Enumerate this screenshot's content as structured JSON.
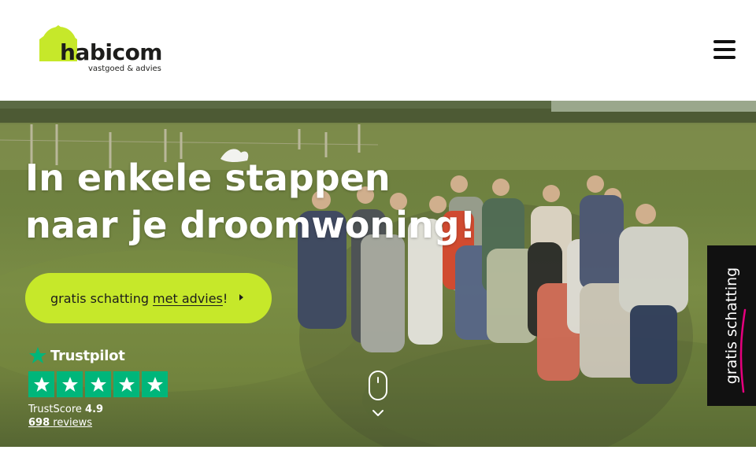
{
  "header": {
    "logo": {
      "word": "habicom",
      "tagline": "vastgoed & advies"
    },
    "menu_icon": "hamburger-menu-icon"
  },
  "hero": {
    "title_line1": "In enkele stappen",
    "title_line2": "naar je droomwoning!",
    "cta": {
      "label_start": "gratis schatting",
      "label_emphasis": "met advies",
      "label_end": "!"
    },
    "trustpilot": {
      "brand": "Trustpilot",
      "stars": 5,
      "score_label": "TrustScore",
      "score_value": "4.9",
      "reviews_count": "698",
      "reviews_label": "reviews"
    },
    "scroll_icon": "mouse-scroll-icon"
  },
  "side_tab": {
    "label": "gratis schatting"
  },
  "colors": {
    "accent": "#c6e82a",
    "trustpilot_green": "#00b67a",
    "dark": "#111111",
    "pink": "#e6007e"
  }
}
